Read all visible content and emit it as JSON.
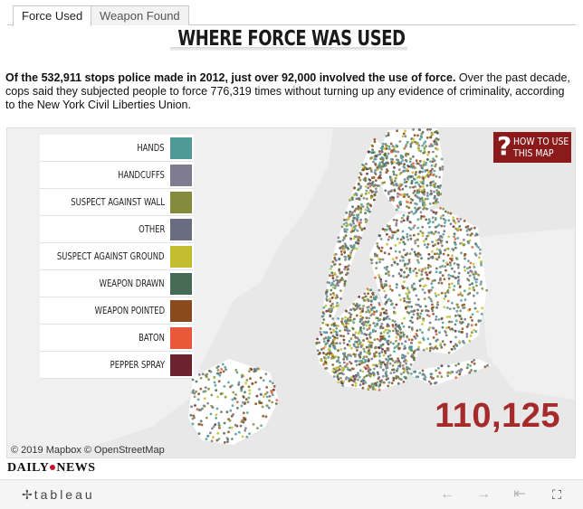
{
  "tabs": [
    {
      "label": "Force Used",
      "active": true
    },
    {
      "label": "Weapon Found",
      "active": false
    }
  ],
  "headline": "WHERE FORCE WAS USED",
  "intro": {
    "bold": "Of the 532,911 stops police made in 2012, just over 92,000 involved the use of force.",
    "rest": " Over the past decade, cops said they subjected people to force 776,319 times without turning up any evidence of criminality, according to the New York Civil Liberties Union."
  },
  "legend": [
    {
      "label": "HANDS",
      "color": "#4f9a96"
    },
    {
      "label": "HANDCUFFS",
      "color": "#7e7c8e"
    },
    {
      "label": "SUSPECT AGAINST WALL",
      "color": "#858a3d"
    },
    {
      "label": "OTHER",
      "color": "#6a6d82"
    },
    {
      "label": "SUSPECT AGAINST GROUND",
      "color": "#c2bd2e"
    },
    {
      "label": "WEAPON DRAWN",
      "color": "#466b55"
    },
    {
      "label": "WEAPON POINTED",
      "color": "#8a4b1c"
    },
    {
      "label": "BATON",
      "color": "#e8593a"
    },
    {
      "label": "PEPPER SPRAY",
      "color": "#6b2330"
    }
  ],
  "how_to": {
    "symbol": "?",
    "line1": "HOW TO USE",
    "line2": "THIS MAP"
  },
  "counter": "110,125",
  "attribution": "© 2019 Mapbox © OpenStreetMap",
  "brand": {
    "part1": "DAILY",
    "part2": "NEWS"
  },
  "footer": {
    "logo_mark": "✢",
    "logo": "tableau",
    "undo_icon": "←",
    "redo_icon": "→",
    "revert_icon": "⇤",
    "fullscreen_icon": "⛶"
  }
}
